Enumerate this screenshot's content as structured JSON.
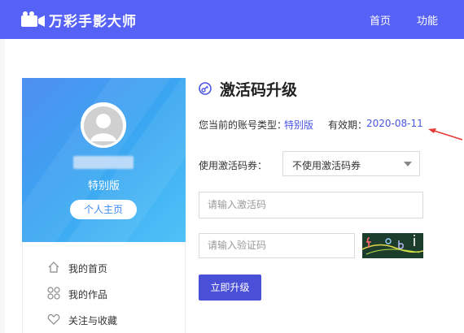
{
  "header": {
    "brand": "万彩手影大师",
    "nav": [
      "首页",
      "功能"
    ]
  },
  "profile": {
    "level": "特别版",
    "home_button": "个人主页"
  },
  "sidebar": {
    "items": [
      {
        "label": "我的首页",
        "icon": "home-icon"
      },
      {
        "label": "我的作品",
        "icon": "works-grid-icon"
      },
      {
        "label": "关注与收藏",
        "icon": "heart-icon"
      }
    ]
  },
  "main": {
    "title": "激活码升级",
    "account_type_label": "您当前的账号类型：",
    "account_type_value": "特别版",
    "expiry_label": "有效期：",
    "expiry_value": "2020-08-11",
    "coupon_label": "使用激活码券：",
    "coupon_selected": "不使用激活码券",
    "activation_placeholder": "请输入激活码",
    "captcha_placeholder": "请输入验证码",
    "submit_label": "立即升级"
  },
  "colors": {
    "accent": "#5662f6",
    "link": "#4a56e2",
    "annotation_arrow": "#e53935"
  }
}
